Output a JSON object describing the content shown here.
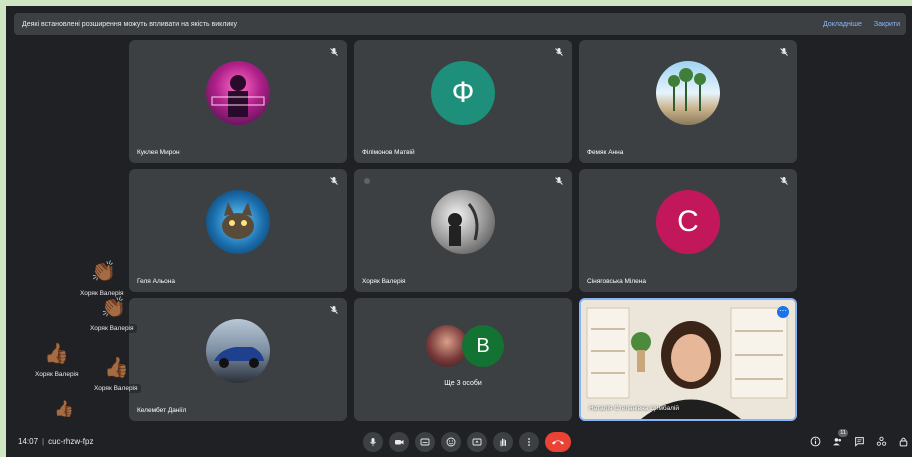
{
  "banner": {
    "text": "Деякі встановлені розширення можуть впливати на якість виклику",
    "details_link": "Докладніше",
    "close_link": "Закрити"
  },
  "tiles": [
    {
      "name": "Куклея Мирон"
    },
    {
      "name": "Філімонов Матвій",
      "initial": "Ф"
    },
    {
      "name": "Фемяк Анна"
    },
    {
      "name": "Геля Альона"
    },
    {
      "name": "Хоряк Валерія"
    },
    {
      "name": "Сіняговська Мілена",
      "initial": "С"
    },
    {
      "name": "Келембет Даніїл"
    },
    {
      "name": "Ще 3 особи",
      "initial": "В"
    },
    {
      "name": "Наталія Степанівна Цимбалій"
    }
  ],
  "reactions": [
    {
      "name": "Хоряк Валерія",
      "emoji": "👏🏾"
    },
    {
      "name": "Хоряк Валерія",
      "emoji": "👏🏾"
    },
    {
      "name": "Хоряк Валерія",
      "emoji": "👍🏾"
    },
    {
      "name": "Хоряк Валерія",
      "emoji": "👍🏾"
    },
    {
      "name": "",
      "emoji": "👍🏾"
    }
  ],
  "bottom": {
    "time": "14:07",
    "meeting_code": "cuc-rhzw-fpz",
    "people_count": "11"
  },
  "colors": {
    "background": "#202124",
    "tile": "#3c4043",
    "leave": "#ea4335",
    "accent_teal": "#1e8f7a",
    "accent_crimson": "#c2185b",
    "accent_green": "#137333"
  },
  "icons": {
    "mic": "microphone-icon",
    "camera": "camera-icon",
    "captions": "captions-icon",
    "emoji": "emoji-icon",
    "present": "present-screen-icon",
    "hand": "raise-hand-icon",
    "more": "more-options-icon",
    "leave": "leave-call-icon",
    "info": "info-icon",
    "people": "people-icon",
    "chat": "chat-icon",
    "activities": "activities-icon",
    "host": "host-controls-icon"
  }
}
